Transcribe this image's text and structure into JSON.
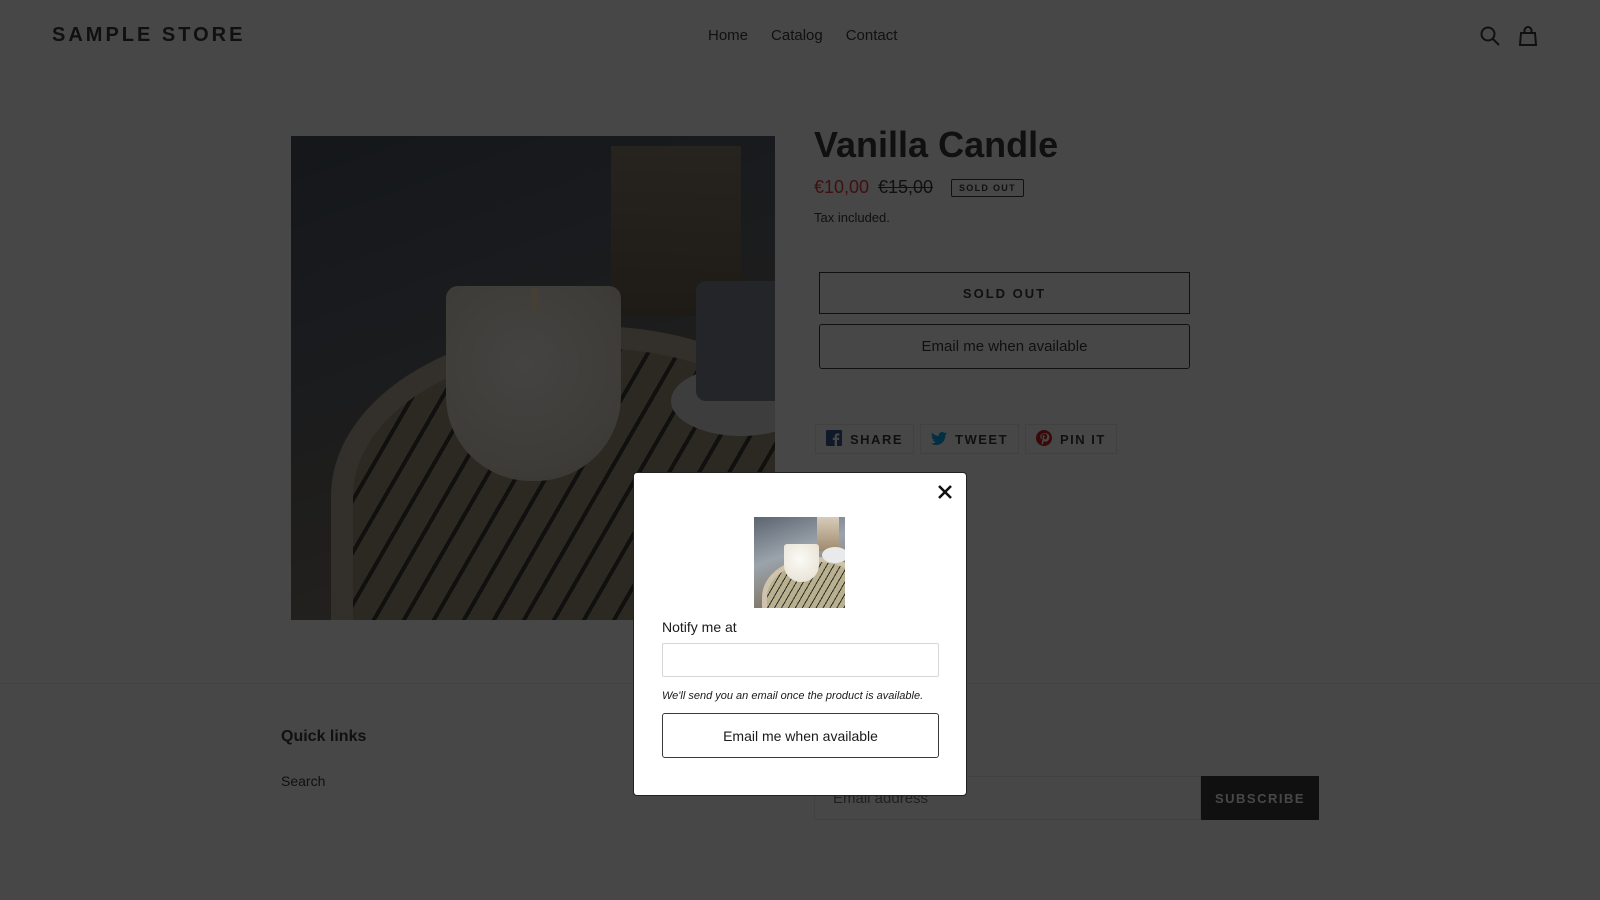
{
  "header": {
    "store_name": "SAMPLE STORE",
    "nav": [
      {
        "label": "Home"
      },
      {
        "label": "Catalog"
      },
      {
        "label": "Contact"
      }
    ],
    "icons": {
      "search": "search-icon",
      "cart": "cart-icon"
    }
  },
  "product": {
    "title": "Vanilla Candle",
    "sale_price": "€10,00",
    "original_price": "€15,00",
    "badge": "SOLD OUT",
    "tax_note": "Tax included.",
    "sold_out_button": "SOLD OUT",
    "notify_button": "Email me when available",
    "share": [
      {
        "label": "SHARE",
        "icon": "facebook-icon",
        "color": "#3b5998"
      },
      {
        "label": "TWEET",
        "icon": "twitter-icon",
        "color": "#00aced"
      },
      {
        "label": "PIN IT",
        "icon": "pinterest-icon",
        "color": "#cb2127"
      }
    ],
    "sale_color": "#e0393e"
  },
  "footer": {
    "quick_links_heading": "Quick links",
    "links": [
      {
        "label": "Search"
      }
    ],
    "newsletter_placeholder": "Email address",
    "subscribe_label": "SUBSCRIBE"
  },
  "modal": {
    "label": "Notify me at",
    "input_value": "",
    "input_placeholder": "",
    "hint": "We'll send you an email once the product is available.",
    "submit_label": "Email me when available",
    "close_icon": "close-icon"
  }
}
